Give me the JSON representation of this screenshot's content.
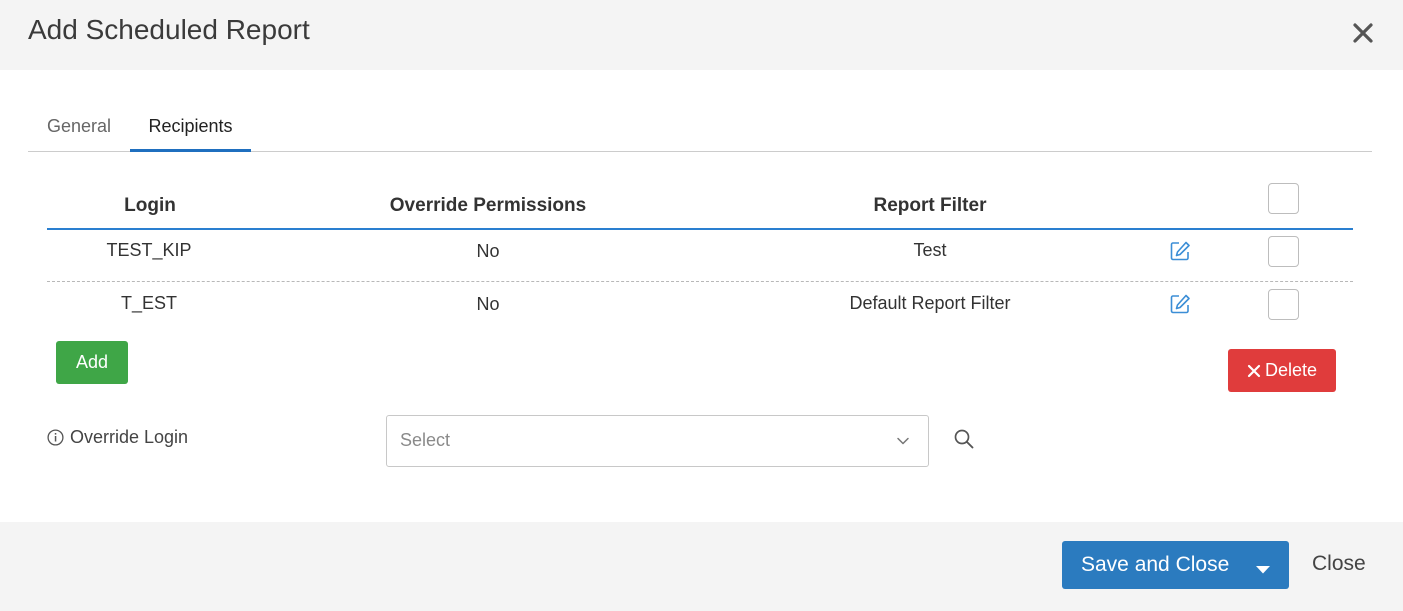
{
  "dialog": {
    "title": "Add Scheduled Report"
  },
  "tabs": [
    {
      "label": "General",
      "active": false
    },
    {
      "label": "Recipients",
      "active": true
    }
  ],
  "table": {
    "columns": [
      "Login",
      "Override Permissions",
      "Report Filter"
    ],
    "rows": [
      {
        "login": "TEST_KIP",
        "override_permissions": "No",
        "report_filter": "Test"
      },
      {
        "login": "T_EST",
        "override_permissions": "No",
        "report_filter": "Default Report Filter"
      }
    ]
  },
  "actions": {
    "add_label": "Add",
    "delete_label": "Delete"
  },
  "override_login": {
    "label": "Override Login",
    "placeholder": "Select"
  },
  "footer": {
    "save_label": "Save and Close",
    "close_label": "Close"
  },
  "colors": {
    "accent": "#2b7bbf",
    "add": "#3fa647",
    "delete": "#e03c3c"
  },
  "icons": {
    "close": "close-icon",
    "edit": "edit-icon",
    "info": "info-icon",
    "chevron": "chevron-down-icon",
    "search": "search-icon",
    "caret": "caret-down-icon"
  }
}
